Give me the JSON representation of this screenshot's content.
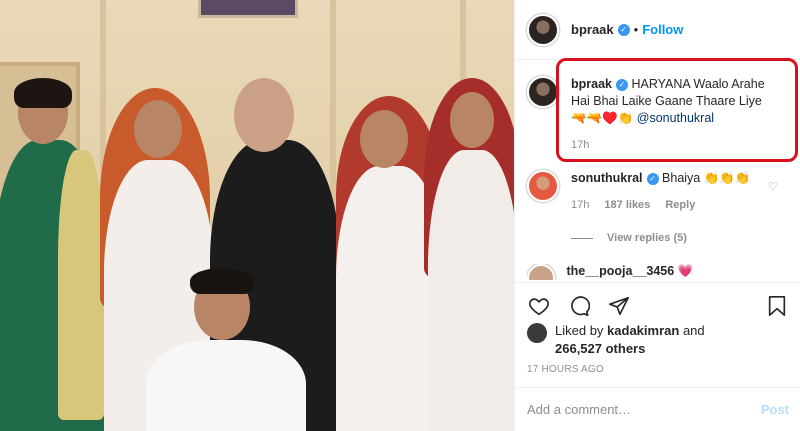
{
  "header": {
    "username": "bpraak",
    "separator": "•",
    "follow_label": "Follow"
  },
  "caption": {
    "username": "bpraak",
    "text": "HARYANA Waalo Arahe Hai Bhai Laike Gaane Thaare Liye🔫🔫♥️👏",
    "mention": "@sonuthukral",
    "time": "17h"
  },
  "comments": [
    {
      "username": "sonuthukral",
      "text": "Bhaiya 👏👏👏",
      "time": "17h",
      "likes": "187 likes",
      "reply_label": "Reply",
      "view_replies": "View replies (5)"
    },
    {
      "username": "the__pooja__3456",
      "text": "💗"
    }
  ],
  "likes": {
    "prefix": "Liked by",
    "user": "kadakimran",
    "and": "and",
    "count": "266,527 others"
  },
  "timestamp": "17 HOURS AGO",
  "add_comment": {
    "placeholder": "Add a comment…",
    "post_label": "Post"
  },
  "colors": {
    "accent": "#0095f6",
    "highlight": "#d8111e",
    "muted": "#8e8e8e"
  }
}
